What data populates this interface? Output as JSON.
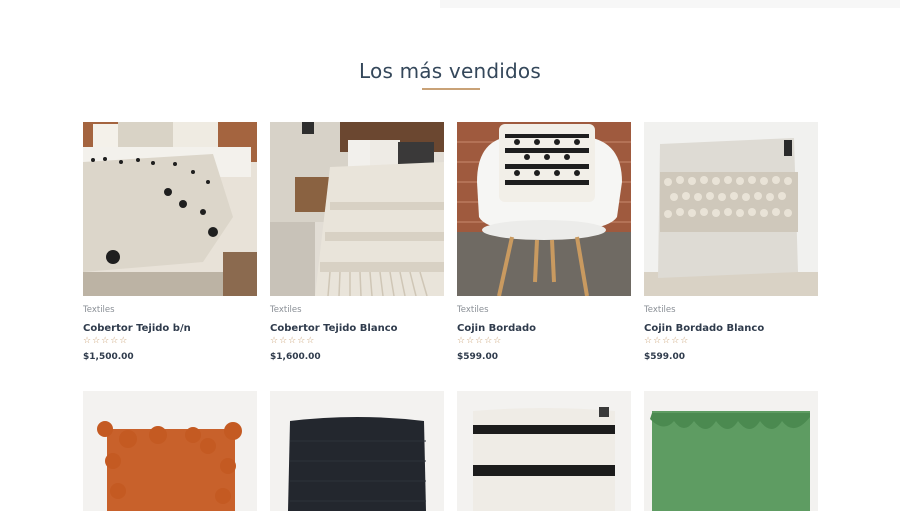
{
  "section": {
    "title": "Los más vendidos"
  },
  "products": [
    {
      "category": "Textiles",
      "name": "Cobertor Tejido b/n",
      "rating": "☆☆☆☆☆",
      "price": "$1,500.00",
      "image_icon": "bed-blanket-image"
    },
    {
      "category": "Textiles",
      "name": "Cobertor Tejido Blanco",
      "rating": "☆☆☆☆☆",
      "price": "$1,600.00",
      "image_icon": "bed-blanket-image"
    },
    {
      "category": "Textiles",
      "name": "Cojin Bordado",
      "rating": "☆☆☆☆☆",
      "price": "$599.00",
      "image_icon": "chair-cushion-image"
    },
    {
      "category": "Textiles",
      "name": "Cojin Bordado Blanco",
      "rating": "☆☆☆☆☆",
      "price": "$599.00",
      "image_icon": "cushion-image"
    }
  ],
  "products_row2": [
    {
      "image_icon": "orange-pompom-cushion-image"
    },
    {
      "image_icon": "black-cushion-image"
    },
    {
      "image_icon": "striped-cushion-image"
    },
    {
      "image_icon": "green-fringe-cushion-image"
    }
  ],
  "colors": {
    "accent": "#c9a277",
    "text": "#2f3b4c",
    "muted": "#8a8f96"
  }
}
